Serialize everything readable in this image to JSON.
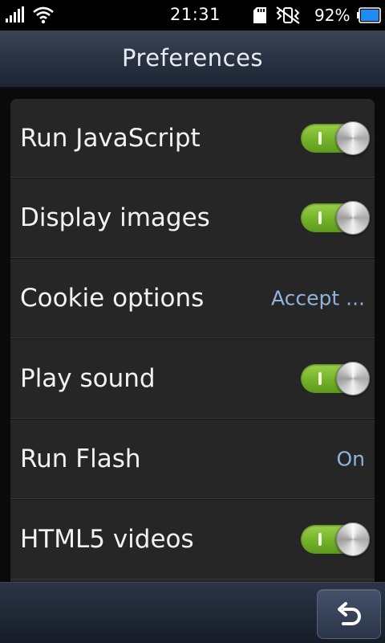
{
  "status_bar": {
    "time": "21:31",
    "battery_percent": "92%",
    "icons": [
      "signal-icon",
      "wifi-icon",
      "sd-card-icon",
      "vibrate-icon",
      "battery-icon"
    ]
  },
  "header": {
    "title": "Preferences"
  },
  "preferences": [
    {
      "label": "Run JavaScript",
      "type": "toggle",
      "on": true
    },
    {
      "label": "Display images",
      "type": "toggle",
      "on": true
    },
    {
      "label": "Cookie options",
      "type": "value",
      "value": "Accept ..."
    },
    {
      "label": "Play sound",
      "type": "toggle",
      "on": true
    },
    {
      "label": "Run Flash",
      "type": "value",
      "value": "On"
    },
    {
      "label": "HTML5 videos",
      "type": "toggle",
      "on": true
    }
  ],
  "footer": {
    "back_icon": "back-arrow-icon"
  },
  "colors": {
    "toggle_on": "#7fbf2e",
    "value_text": "#8fb3dc",
    "header_bg": "#2a3444",
    "card_bg": "#262626"
  }
}
